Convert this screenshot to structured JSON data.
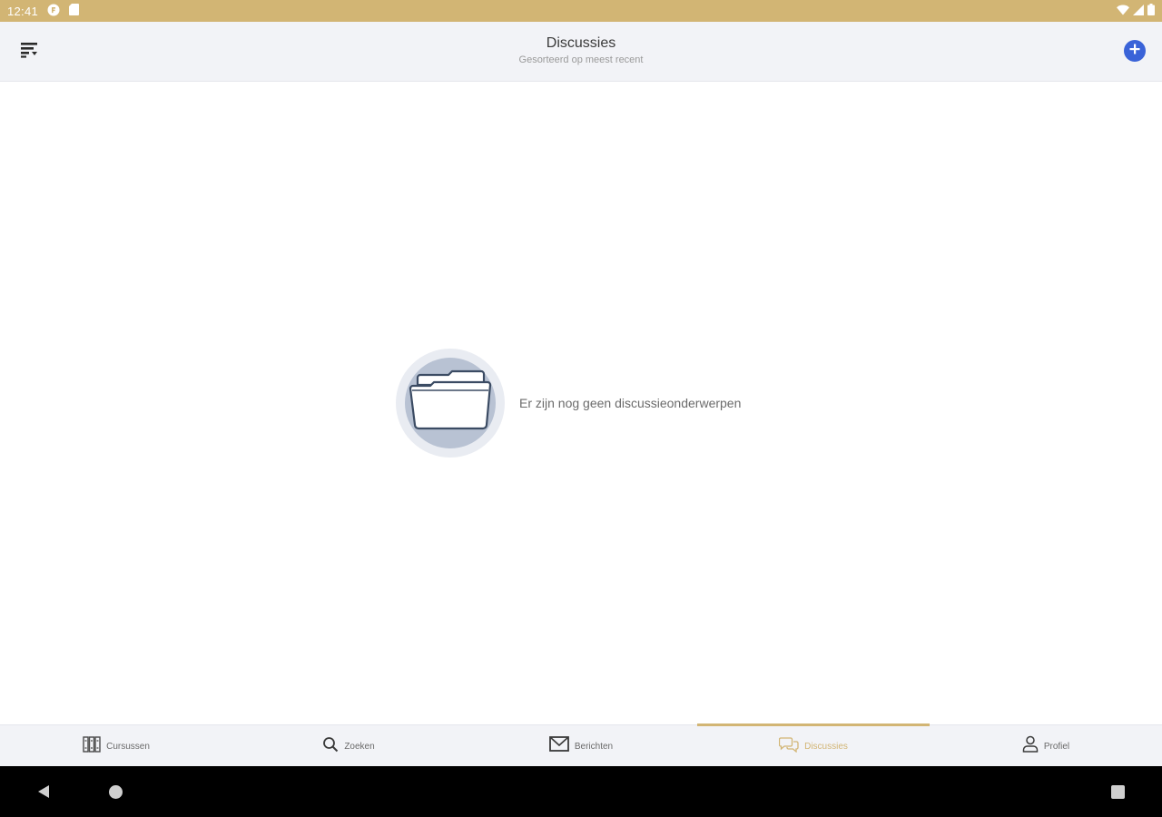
{
  "status_bar": {
    "time": "12:41",
    "background": "#d2b574"
  },
  "header": {
    "title": "Discussies",
    "subtitle": "Gesorteerd op meest recent",
    "accent_color": "#3a63d8",
    "left_icon": "sort-icon",
    "right_icon": "add-circle-icon"
  },
  "empty_state": {
    "message": "Er zijn nog geen discussieonderwerpen",
    "icon": "folder-icon"
  },
  "bottom_nav": {
    "active_color": "#d2b574",
    "items": [
      {
        "label": "Cursussen",
        "icon": "courses-icon",
        "active": false
      },
      {
        "label": "Zoeken",
        "icon": "search-icon",
        "active": false
      },
      {
        "label": "Berichten",
        "icon": "mail-icon",
        "active": false
      },
      {
        "label": "Discussies",
        "icon": "chat-icon",
        "active": true
      },
      {
        "label": "Profiel",
        "icon": "profile-icon",
        "active": false
      }
    ]
  }
}
